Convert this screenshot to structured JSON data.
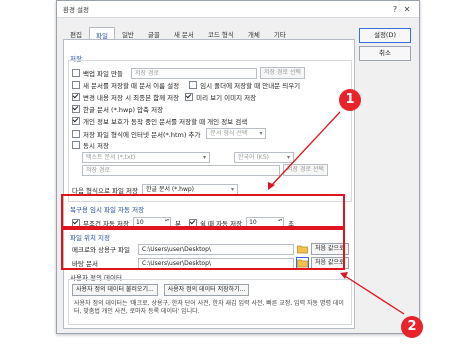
{
  "window": {
    "title": "환경 설정",
    "help_icon": "?",
    "close_icon": "✕"
  },
  "tabs": [
    "편집",
    "파일",
    "일반",
    "글꼴",
    "새 문서",
    "코드 형식",
    "개체",
    "기타"
  ],
  "active_tab": "파일",
  "side_buttons": {
    "ok": "설정(D)",
    "cancel": "취소"
  },
  "save_section": {
    "label": "저장",
    "backup": {
      "label": "백업 파일 만들",
      "checked": false,
      "path_placeholder": "저장 경로",
      "browse": "저장 경로 선택"
    },
    "new_doc_path": {
      "label": "새 문서를 저장할 때 문서 이름 설정",
      "checked": false
    },
    "no_warn": {
      "label": "임시 폴더에 저장할 때 안내문 띄우기",
      "checked": false
    },
    "save_with_changes": {
      "label": "변경 내용 저장 시 최종본 함께 저장",
      "checked": true
    },
    "preview_image": {
      "label": "미리 보기 이미지 저장",
      "checked": true
    },
    "compress": {
      "label": "한글 문서 (*.hwp) 압축 저장",
      "checked": true
    },
    "personal_info": {
      "label": "개인 정보 보호가 동작 중인 문서를 저장할 때 개인 정보 검색",
      "checked": true
    },
    "web_format": {
      "label": "저장 파일 형식에 인터넷 문서(*.htm) 추가",
      "checked": false,
      "select": "문서 형식 선택"
    },
    "sync_save": {
      "label": "동시 저장",
      "checked": false
    },
    "text_doc_select": "텍스트 문서 (*.txt)",
    "encoding_select": "한국어 (KS)",
    "save_path_placeholder": "저장 경로",
    "save_path_btn": "저장 경로 선택",
    "default_format_label": "다음 형식으로 파일 저장",
    "default_format_value": "한글 문서 (*.hwp)"
  },
  "autosave_section": {
    "label": "복구용 임시 파일 자동 저장",
    "idle": {
      "label": "무조건 자동 저장",
      "checked": true,
      "value": "10",
      "unit": "분"
    },
    "interval": {
      "label": "쉴 때 자동 저장",
      "checked": true,
      "value": "10",
      "unit": "초"
    }
  },
  "location_section": {
    "label": "파일 위치 지정",
    "clipboard": {
      "label": "메크로와 상용구 파일",
      "path": "C:\\Users\\user\\Desktop\\",
      "btn": "처음 값으로"
    },
    "desktop": {
      "label": "바탕 문서",
      "path": "C:\\Users\\user\\Desktop\\",
      "btn": "처음 값으로"
    }
  },
  "dictionary_section": {
    "label": "사용자 정의 데이터",
    "import_btn": "사용자 정의 데이터 불러오기...",
    "export_btn": "사용자 정의 데이터 저장하기...",
    "desc": "사용자 정의 데이터는 '매크로, 상용구, 한자 단어 사전, 한자 새김 입력 사전, 빠른 교정, 입력 자동 명령 데이터, 맞춤법 개인 사전, 로마자 등록 데이터' 입니다."
  },
  "callouts": [
    "1",
    "2"
  ],
  "colors": {
    "highlight": "#e0141e",
    "callout": "#e8232b",
    "section_label": "#1f4aa8"
  }
}
